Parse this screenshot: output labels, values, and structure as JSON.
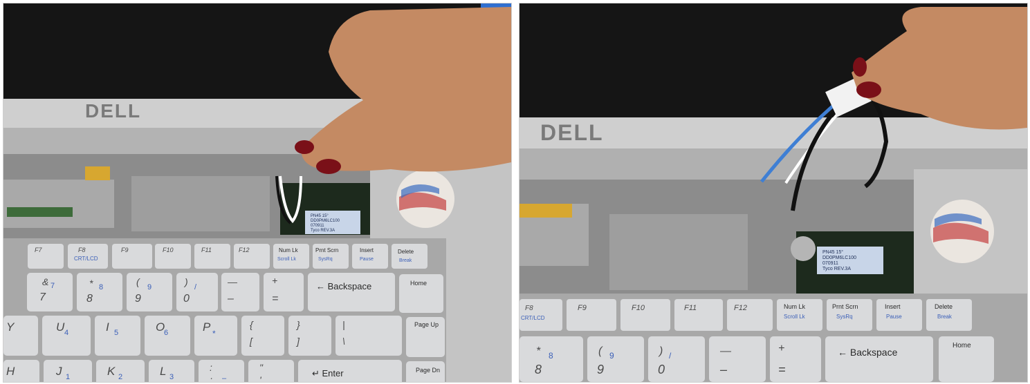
{
  "panels": [
    {
      "brand": "DELL",
      "label_lines": [
        "PN45 15°",
        "DD0PM6LC100",
        "070911",
        "Tyco REV.3A"
      ],
      "keys_row1": [
        {
          "main": "F7",
          "sub": ""
        },
        {
          "main": "F8",
          "sub": "CRT/LCD"
        },
        {
          "main": "F9",
          "sub": ""
        },
        {
          "main": "F10",
          "sub": ""
        },
        {
          "main": "F11",
          "sub": ""
        },
        {
          "main": "F12",
          "sub": ""
        },
        {
          "main": "Num Lk",
          "sub": "Scroll Lk"
        },
        {
          "main": "Prnt Scrn",
          "sub": "SysRq"
        },
        {
          "main": "Insert",
          "sub": "Pause"
        },
        {
          "main": "Delete",
          "sub": "Break"
        }
      ],
      "keys_row2": [
        {
          "main": "&",
          "second": "7",
          "sub": "7"
        },
        {
          "main": "*",
          "second": "8",
          "sub": "8"
        },
        {
          "main": "(",
          "second": "9",
          "sub": "9"
        },
        {
          "main": ")",
          "second": "0",
          "sub": "/"
        },
        {
          "main": "—",
          "second": "–",
          "sub": ""
        },
        {
          "main": "+",
          "second": "=",
          "sub": ""
        },
        {
          "main": "← Backspace",
          "second": "",
          "sub": ""
        },
        {
          "main": "Home",
          "second": "",
          "sub": ""
        }
      ],
      "keys_row3": [
        {
          "main": "Y",
          "sub": ""
        },
        {
          "main": "U",
          "sub": "4"
        },
        {
          "main": "I",
          "sub": "5"
        },
        {
          "main": "O",
          "sub": "6"
        },
        {
          "main": "P",
          "sub": "*"
        },
        {
          "main": "{",
          "second": "[",
          "sub": ""
        },
        {
          "main": "}",
          "second": "]",
          "sub": ""
        },
        {
          "main": "|",
          "second": "\\",
          "sub": ""
        },
        {
          "main": "Page Up",
          "sub": ""
        }
      ],
      "keys_row4": [
        {
          "main": "H",
          "sub": ""
        },
        {
          "main": "J",
          "sub": "1"
        },
        {
          "main": "K",
          "sub": "2"
        },
        {
          "main": "L",
          "sub": "3"
        },
        {
          "main": ":",
          "second": ";",
          "sub": "–"
        },
        {
          "main": "\"",
          "second": "'",
          "sub": ""
        },
        {
          "main": "↵ Enter",
          "sub": ""
        },
        {
          "main": "Page Dn",
          "sub": ""
        }
      ]
    },
    {
      "brand": "DELL",
      "label_lines": [
        "PN45 15°",
        "DD0PM6LC100",
        "070911",
        "Tyco REV.3A"
      ],
      "keys_row1": [
        {
          "main": "F8",
          "sub": "CRT/LCD"
        },
        {
          "main": "F9",
          "sub": ""
        },
        {
          "main": "F10",
          "sub": ""
        },
        {
          "main": "F11",
          "sub": ""
        },
        {
          "main": "F12",
          "sub": ""
        },
        {
          "main": "Num Lk",
          "sub": "Scroll Lk"
        },
        {
          "main": "Prnt Scrn",
          "sub": "SysRq"
        },
        {
          "main": "Insert",
          "sub": "Pause"
        },
        {
          "main": "Delete",
          "sub": "Break"
        }
      ],
      "keys_row2": [
        {
          "main": "*",
          "second": "8",
          "sub": "8"
        },
        {
          "main": "(",
          "second": "9",
          "sub": "9"
        },
        {
          "main": ")",
          "second": "0",
          "sub": "/"
        },
        {
          "main": "—",
          "second": "–",
          "sub": ""
        },
        {
          "main": "+",
          "second": "=",
          "sub": ""
        },
        {
          "main": "← Backspace",
          "second": "",
          "sub": ""
        },
        {
          "main": "Home",
          "second": "",
          "sub": ""
        }
      ]
    }
  ],
  "colors": {
    "screen": "#1c1c1c",
    "bezel": "#c9c9c9",
    "palmrest": "#b9b9b9",
    "key": "#d9dadc",
    "skin": "#c98f68",
    "nail": "#7a1018",
    "wire_blue": "#3f7fd4"
  }
}
